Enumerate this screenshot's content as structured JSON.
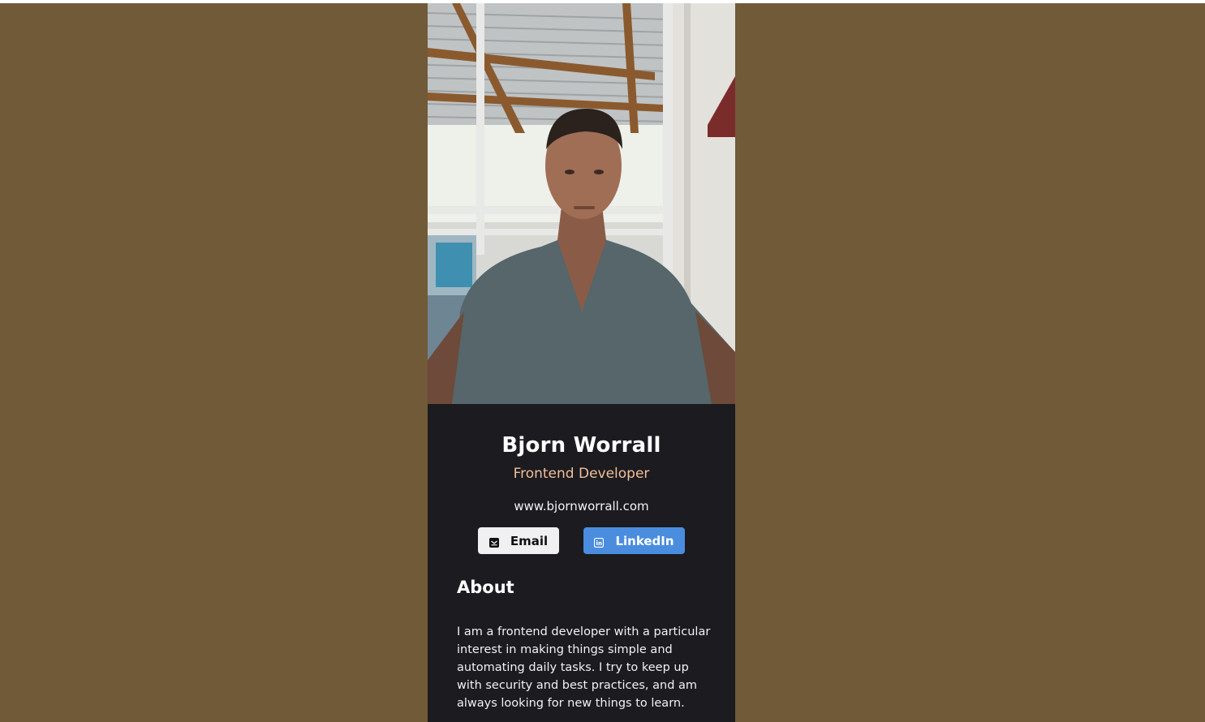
{
  "profile": {
    "name": "Bjorn Worrall",
    "role": "Frontend Developer",
    "website": "www.bjornworrall.com"
  },
  "buttons": {
    "email_label": "Email",
    "email_icon": "envelope-icon",
    "linkedin_label": "LinkedIn",
    "linkedin_icon": "linkedin-icon"
  },
  "about": {
    "heading": "About",
    "text": "I am a frontend developer with a particular interest in making things simple and automating daily tasks. I try to keep up with security and best practices, and am always looking for new things to learn."
  },
  "colors": {
    "page_background": "#715a38",
    "card_background": "#1b1b20",
    "role_accent": "#f3bf99",
    "linkedin_blue": "#4a8ddf",
    "email_button": "#f0f0f2"
  }
}
